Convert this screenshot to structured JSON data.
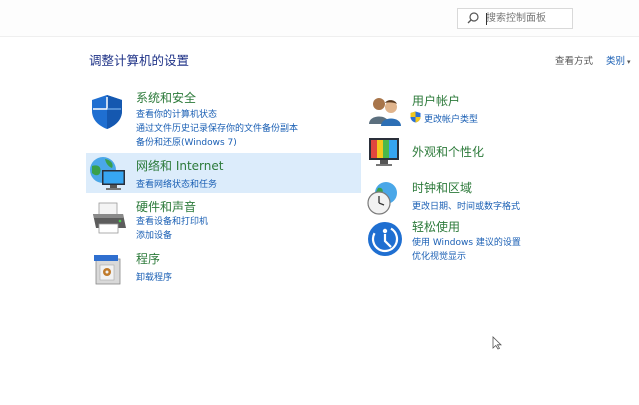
{
  "search": {
    "placeholder": "搜索控制面板"
  },
  "page_title": "调整计算机的设置",
  "view": {
    "label": "查看方式",
    "mode": "类别"
  },
  "categories": [
    {
      "title": "系统和安全",
      "links": [
        "查看你的计算机状态",
        "通过文件历史记录保存你的文件备份副本",
        "备份和还原(Windows 7)"
      ]
    },
    {
      "title": "网络和 Internet",
      "links": [
        "查看网络状态和任务"
      ]
    },
    {
      "title": "硬件和声音",
      "links": [
        "查看设备和打印机",
        "添加设备"
      ]
    },
    {
      "title": "程序",
      "links": [
        "卸载程序"
      ]
    },
    {
      "title": "用户帐户",
      "links": [
        "更改帐户类型"
      ]
    },
    {
      "title": "外观和个性化",
      "links": []
    },
    {
      "title": "时钟和区域",
      "links": [
        "更改日期、时间或数字格式"
      ]
    },
    {
      "title": "轻松使用",
      "links": [
        "使用 Windows 建议的设置",
        "优化视觉显示"
      ]
    }
  ]
}
